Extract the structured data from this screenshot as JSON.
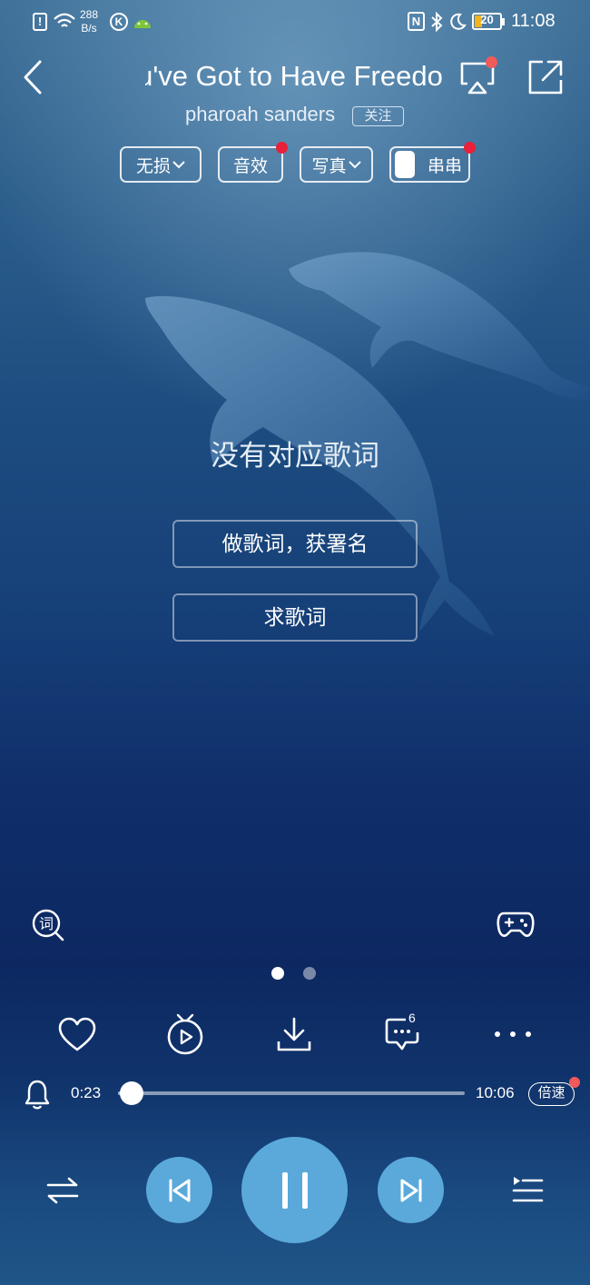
{
  "status_bar": {
    "net_speed_value": "288",
    "net_speed_unit": "B/s",
    "battery": "20",
    "time": "11:08"
  },
  "header": {
    "title": "You've Got to Have Freedom",
    "artist": "pharoah sanders",
    "follow_label": "关注"
  },
  "chips": {
    "quality": "无损",
    "effects": "音效",
    "portrait": "写真",
    "chuanchuan": "串串"
  },
  "lyrics": {
    "no_lyrics": "没有对应歌词",
    "make_lyrics": "做歌词，获署名",
    "request_lyrics": "求歌词"
  },
  "actions": {
    "comment_count": "6"
  },
  "playback": {
    "elapsed": "0:23",
    "duration": "10:06",
    "progress": 0.038,
    "speed_label": "倍速"
  },
  "pager": {
    "pages": 2,
    "active": 0
  },
  "colors": {
    "accent": "#5aa9da",
    "badge": "#e8203a"
  }
}
